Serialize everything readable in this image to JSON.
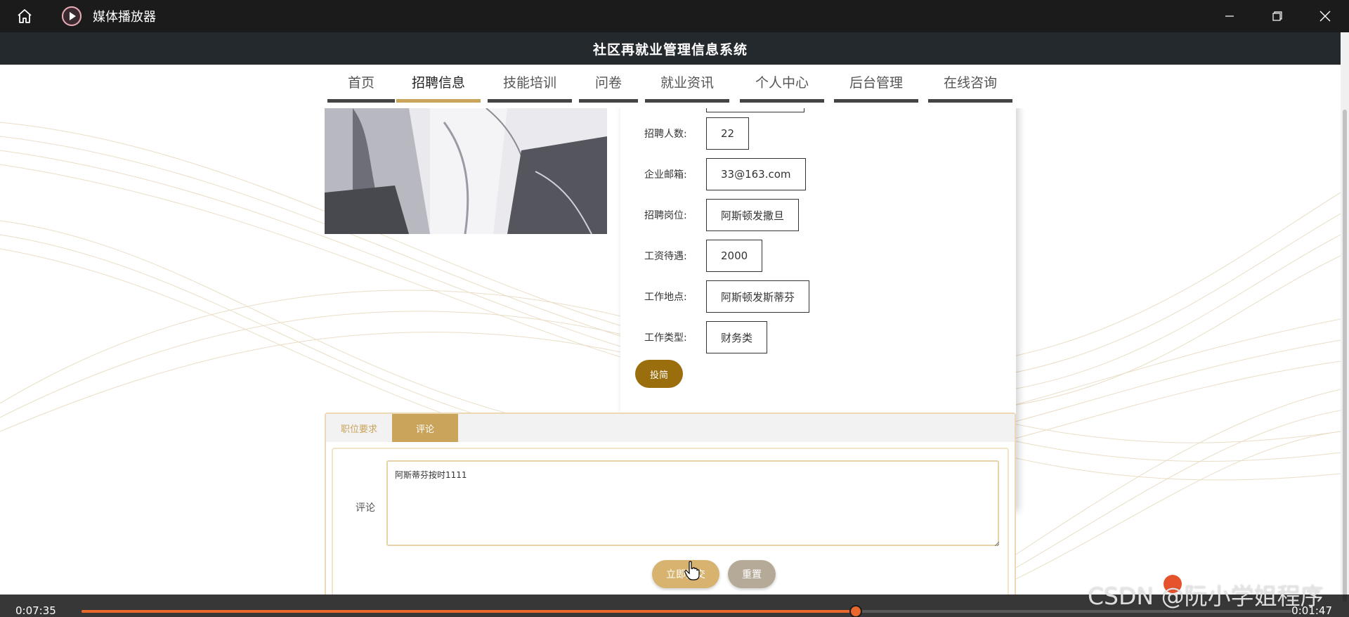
{
  "player": {
    "title": "媒体播放器",
    "icons": {
      "home": "home-icon",
      "logo": "play-icon",
      "minimize": "minimize-icon",
      "restore": "restore-icon",
      "close": "close-icon"
    }
  },
  "site": {
    "title": "社区再就业管理信息系统"
  },
  "nav": {
    "items": [
      "首页",
      "招聘信息",
      "技能培训",
      "问卷",
      "就业资讯",
      "个人中心",
      "后台管理",
      "在线咨询"
    ],
    "active": "招聘信息",
    "accent_color": "#c9a45a"
  },
  "detail": {
    "fields": [
      {
        "label": "招聘人数:",
        "value": "22"
      },
      {
        "label": "企业邮箱:",
        "value": "33@163.com"
      },
      {
        "label": "招聘岗位:",
        "value": "阿斯顿发撒旦"
      },
      {
        "label": "工资待遇:",
        "value": "2000"
      },
      {
        "label": "工作地点:",
        "value": "阿斯顿发斯蒂芬"
      },
      {
        "label": "工作类型:",
        "value": "财务类"
      }
    ],
    "apply_label": "投简",
    "apply_color": "#9a6d0d"
  },
  "tabs": {
    "items": [
      "职位要求",
      "评论"
    ],
    "active": "评论"
  },
  "comment": {
    "label": "评论",
    "value": "阿斯蒂芬按时1111",
    "submit_label": "立即提交",
    "reset_label": "重置"
  },
  "playback": {
    "current_time": "0:07:35",
    "remaining_time": "0:01:47",
    "progress": 0.64,
    "accent_color": "#e9692c"
  },
  "watermark": "CSDN @阮小学姐程序"
}
